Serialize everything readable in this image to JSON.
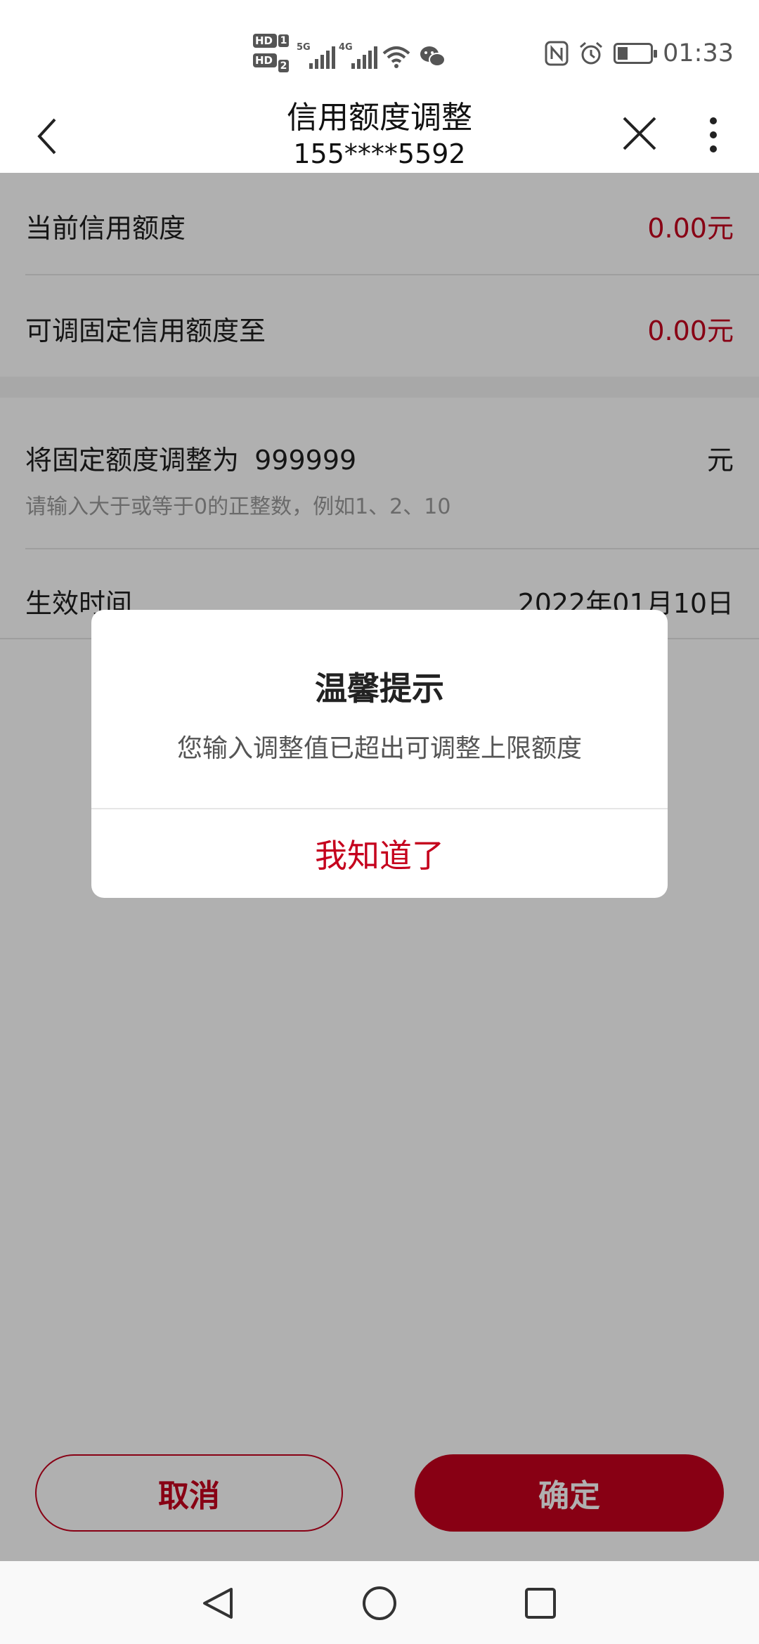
{
  "status_bar": {
    "time": "01:33",
    "sim1": "1",
    "sim2": "2",
    "hd_label": "HD",
    "net1": "5G",
    "net2": "4G",
    "battery_level": 0.3
  },
  "header": {
    "title": "信用额度调整",
    "subtitle": "155****5592"
  },
  "credit": {
    "current_label": "当前信用额度",
    "current_value": "0.00元",
    "adjustable_label": "可调固定信用额度至",
    "adjustable_value": "0.00元"
  },
  "adjust": {
    "label": "将固定额度调整为",
    "input_value": "999999",
    "unit": "元",
    "hint": "请输入大于或等于0的正整数，例如1、2、10",
    "effective_label": "生效时间",
    "effective_value": "2022年01月10日"
  },
  "buttons": {
    "cancel": "取消",
    "confirm": "确定"
  },
  "dialog": {
    "title": "温馨提示",
    "message": "您输入调整值已超出可调整上限额度",
    "ok": "我知道了"
  },
  "colors": {
    "accent": "#c5001d",
    "overlay": "rgba(0,0,0,0.31)"
  }
}
